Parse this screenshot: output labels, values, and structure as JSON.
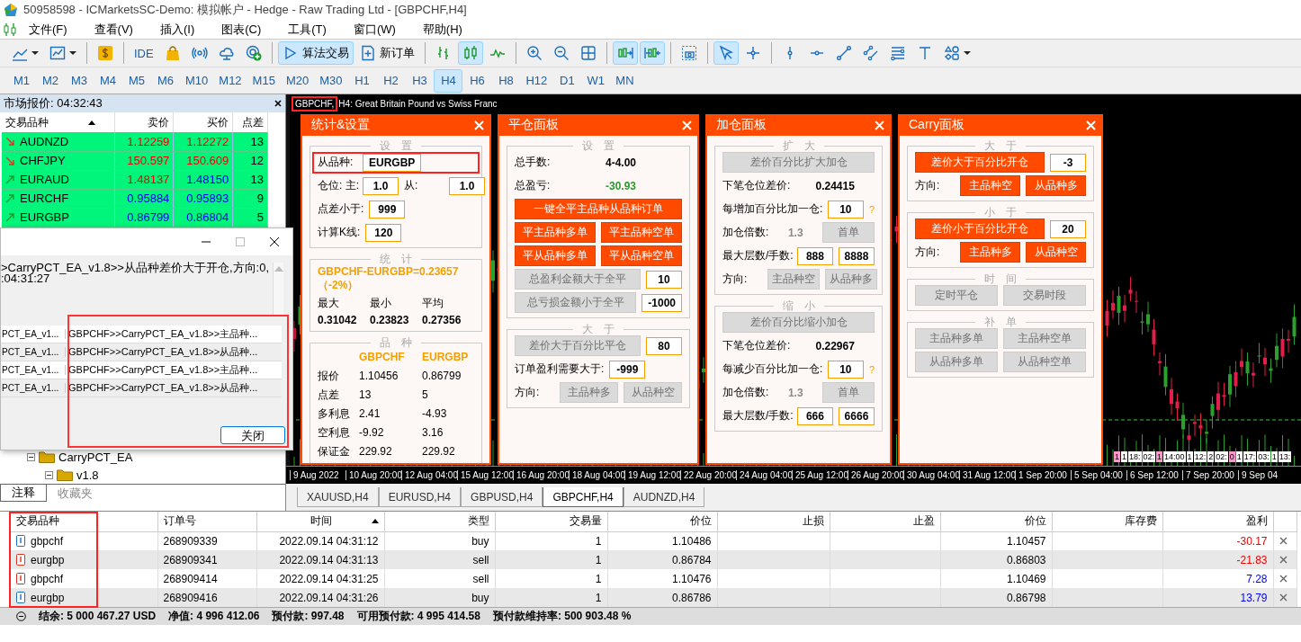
{
  "window": {
    "title": "50958598 - ICMarketsSC-Demo: 模拟帐户 - Hedge - Raw Trading Ltd - [GBPCHF,H4]"
  },
  "menu": [
    "文件(F)",
    "查看(V)",
    "插入(I)",
    "图表(C)",
    "工具(T)",
    "窗口(W)",
    "帮助(H)"
  ],
  "toolbar": [
    {
      "kind": "icon",
      "selected": false
    },
    {
      "kind": "icon",
      "selected": false
    },
    {
      "kind": "separator"
    },
    {
      "kind": "icon",
      "selected": false
    },
    {
      "kind": "separator"
    },
    {
      "kind": "text",
      "label": "IDE",
      "selected": false
    },
    {
      "kind": "icon",
      "selected": false
    },
    {
      "kind": "icon",
      "selected": false
    },
    {
      "kind": "icon",
      "selected": false
    },
    {
      "kind": "icon",
      "selected": false
    },
    {
      "kind": "separator"
    },
    {
      "kind": "text",
      "label": "算法交易",
      "selected": true
    },
    {
      "kind": "text",
      "label": "新订单",
      "selected": false
    },
    {
      "kind": "separator"
    },
    {
      "kind": "icon",
      "selected": false
    },
    {
      "kind": "icon",
      "selected": true
    },
    {
      "kind": "icon",
      "selected": false
    },
    {
      "kind": "separator"
    },
    {
      "kind": "icon",
      "selected": false
    },
    {
      "kind": "icon",
      "selected": false
    },
    {
      "kind": "icon",
      "selected": false
    },
    {
      "kind": "separator"
    },
    {
      "kind": "icon",
      "selected": true
    },
    {
      "kind": "icon",
      "selected": true
    },
    {
      "kind": "separator"
    },
    {
      "kind": "icon",
      "selected": false
    },
    {
      "kind": "separator"
    },
    {
      "kind": "icon",
      "selected": true
    },
    {
      "kind": "icon",
      "selected": false
    },
    {
      "kind": "separator"
    },
    {
      "kind": "icon",
      "selected": false
    },
    {
      "kind": "icon",
      "selected": false
    },
    {
      "kind": "icon",
      "selected": false
    },
    {
      "kind": "icon",
      "selected": false
    },
    {
      "kind": "icon",
      "selected": false
    },
    {
      "kind": "icon",
      "selected": false
    },
    {
      "kind": "icon",
      "selected": false
    }
  ],
  "timeframes": [
    {
      "label": "M1",
      "selected": false
    },
    {
      "label": "M2",
      "selected": false
    },
    {
      "label": "M3",
      "selected": false
    },
    {
      "label": "M4",
      "selected": false
    },
    {
      "label": "M5",
      "selected": false
    },
    {
      "label": "M6",
      "selected": false
    },
    {
      "label": "M10",
      "selected": false
    },
    {
      "label": "M12",
      "selected": false
    },
    {
      "label": "M15",
      "selected": false
    },
    {
      "label": "M20",
      "selected": false
    },
    {
      "label": "M30",
      "selected": false
    },
    {
      "label": "H1",
      "selected": false
    },
    {
      "label": "H2",
      "selected": false
    },
    {
      "label": "H3",
      "selected": false
    },
    {
      "label": "H4",
      "selected": true
    },
    {
      "label": "H6",
      "selected": false
    },
    {
      "label": "H8",
      "selected": false
    },
    {
      "label": "H12",
      "selected": false
    },
    {
      "label": "D1",
      "selected": false
    },
    {
      "label": "W1",
      "selected": false
    },
    {
      "label": "MN",
      "selected": false
    }
  ],
  "market_watch": {
    "title": "市场报价: 04:32:43",
    "columns": [
      {
        "label": "交易品种",
        "sorted": true
      },
      {
        "label": "卖价",
        "sorted": false
      },
      {
        "label": "买价",
        "sorted": false
      },
      {
        "label": "点差",
        "sorted": false
      }
    ],
    "rows": [
      {
        "symbol": "AUDNZD",
        "falling": true,
        "bid": "1.12259",
        "bid_falling": true,
        "ask": "1.12272",
        "ask_falling": true,
        "spread": "13"
      },
      {
        "symbol": "CHFJPY",
        "falling": true,
        "bid": "150.597",
        "bid_falling": true,
        "ask": "150.609",
        "ask_falling": true,
        "spread": "12"
      },
      {
        "symbol": "EURAUD",
        "falling": false,
        "bid": "1.48137",
        "bid_falling": true,
        "ask": "1.48150",
        "ask_falling": false,
        "spread": "13"
      },
      {
        "symbol": "EURCHF",
        "falling": false,
        "bid": "0.95884",
        "bid_falling": false,
        "ask": "0.95893",
        "ask_falling": false,
        "spread": "9"
      },
      {
        "symbol": "EURGBP",
        "falling": false,
        "bid": "0.86799",
        "bid_falling": false,
        "ask": "0.86804",
        "ask_falling": false,
        "spread": "5"
      }
    ]
  },
  "dialog": {
    "message": [
      ">CarryPCT_EA_v1.8>>从品种差价大于开仓,方向:0,",
      ":04:31:27"
    ],
    "highlighted": true,
    "rows": [
      {
        "column_1": "PCT_EA_v1...",
        "column_2": "GBPCHF>>CarryPCT_EA_v1.8>>主品种..."
      },
      {
        "column_1": "PCT_EA_v1...",
        "column_2": "GBPCHF>>CarryPCT_EA_v1.8>>从品种..."
      },
      {
        "column_1": "PCT_EA_v1...",
        "column_2": "GBPCHF>>CarryPCT_EA_v1.8>>主品种..."
      },
      {
        "column_1": "PCT_EA_v1...",
        "column_2": "GBPCHF>>CarryPCT_EA_v1.8>>从品种..."
      }
    ],
    "button": "关闭"
  },
  "navigator": {
    "tree": [
      {
        "label": "CarryPCT_EA",
        "expanded": true,
        "children": [
          {
            "label": "v1.8",
            "expanded": true
          }
        ]
      }
    ],
    "tabs": [
      {
        "label": "注释",
        "selected": true
      },
      {
        "label": "收藏夹",
        "selected": false
      }
    ]
  },
  "chart": {
    "symbol": "GBPCHF,",
    "symbol_highlighted": true,
    "description": "H4:  Great Britain Pound vs Swiss Franc",
    "panels": [
      {
        "title": "统计&设置",
        "sections": [
          {
            "title": "设　置",
            "rows": [
              {
                "kind": "line",
                "highlighted": true,
                "items": [
                  {
                    "kind": "label",
                    "text": "从品种:"
                  },
                  {
                    "kind": "input",
                    "value": "EURGBP"
                  }
                ]
              },
              {
                "kind": "line",
                "items": [
                  {
                    "kind": "label",
                    "text": "仓位: 主:"
                  },
                  {
                    "kind": "input",
                    "value": "1.0"
                  },
                  {
                    "kind": "label",
                    "text": "从:"
                  },
                  {
                    "kind": "input",
                    "value": "1.0"
                  }
                ]
              },
              {
                "kind": "line",
                "items": [
                  {
                    "kind": "label",
                    "text": "点差小于:"
                  },
                  {
                    "kind": "input",
                    "value": "999"
                  }
                ]
              },
              {
                "kind": "line",
                "items": [
                  {
                    "kind": "label",
                    "text": "计算K线:"
                  },
                  {
                    "kind": "input",
                    "value": "120"
                  }
                ]
              }
            ]
          },
          {
            "title": "统　计",
            "rows": [
              {
                "kind": "line",
                "items": [
                  {
                    "kind": "accent",
                    "text": "GBPCHF-EURGBP=0.23657（-2%）"
                  }
                ]
              },
              {
                "kind": "stat",
                "bold": false,
                "cells": [
                  "最大",
                  "最小",
                  "平均"
                ]
              },
              {
                "kind": "stat",
                "bold": true,
                "cells": [
                  "0.31042",
                  "0.23823",
                  "0.27356"
                ]
              }
            ]
          },
          {
            "title": "品　种",
            "rows": [
              {
                "kind": "table_head",
                "cells": [
                  "GBPCHF",
                  "EURGBP"
                ]
              },
              {
                "kind": "table",
                "label": "报价",
                "cells": [
                  "1.10456",
                  "0.86799"
                ]
              },
              {
                "kind": "table",
                "label": "点差",
                "cells": [
                  "13",
                  "5"
                ]
              },
              {
                "kind": "table",
                "label": "多利息",
                "cells": [
                  "2.41",
                  "-4.93"
                ]
              },
              {
                "kind": "table",
                "label": "空利息",
                "cells": [
                  "-9.92",
                  "3.16"
                ]
              },
              {
                "kind": "table",
                "label": "保证金",
                "cells": [
                  "229.92",
                  "229.92"
                ]
              }
            ]
          }
        ]
      },
      {
        "title": "平仓面板",
        "sections": [
          {
            "title": "设　置",
            "rows": [
              {
                "kind": "line",
                "items": [
                  {
                    "kind": "label",
                    "text": "总手数:"
                  },
                  {
                    "kind": "value",
                    "text": "4-4.00"
                  }
                ]
              },
              {
                "kind": "line",
                "items": [
                  {
                    "kind": "label",
                    "text": "总盈亏:"
                  },
                  {
                    "kind": "gain",
                    "text": "-30.93"
                  }
                ]
              },
              {
                "kind": "line",
                "items": [
                  {
                    "kind": "button",
                    "text": "一键全平主品种从品种订单",
                    "enabled": true
                  }
                ]
              },
              {
                "kind": "line",
                "items": [
                  {
                    "kind": "button",
                    "text": "平主品种多单",
                    "enabled": true
                  },
                  {
                    "kind": "button",
                    "text": "平主品种空单",
                    "enabled": true
                  }
                ]
              },
              {
                "kind": "line",
                "items": [
                  {
                    "kind": "button",
                    "text": "平从品种多单",
                    "enabled": true
                  },
                  {
                    "kind": "button",
                    "text": "平从品种空单",
                    "enabled": true
                  }
                ]
              },
              {
                "kind": "line",
                "items": [
                  {
                    "kind": "button",
                    "text": "总盈利金额大于全平",
                    "enabled": false
                  },
                  {
                    "kind": "input",
                    "value": "10"
                  }
                ]
              },
              {
                "kind": "line",
                "items": [
                  {
                    "kind": "button",
                    "text": "总亏损金额小于全平",
                    "enabled": false
                  },
                  {
                    "kind": "input",
                    "value": "-1000"
                  }
                ]
              }
            ]
          },
          {
            "title": "大　于",
            "rows": [
              {
                "kind": "line",
                "items": [
                  {
                    "kind": "button",
                    "text": "差价大于百分比平仓",
                    "enabled": false
                  },
                  {
                    "kind": "input",
                    "value": "80"
                  }
                ]
              },
              {
                "kind": "line",
                "items": [
                  {
                    "kind": "label",
                    "text": "订单盈利需要大于:"
                  },
                  {
                    "kind": "input",
                    "value": "-999"
                  }
                ]
              },
              {
                "kind": "line",
                "items": [
                  {
                    "kind": "label",
                    "text": "方向:"
                  },
                  {
                    "kind": "button",
                    "text": "主品种多",
                    "enabled": false
                  },
                  {
                    "kind": "button",
                    "text": "从品种空",
                    "enabled": false
                  }
                ]
              }
            ]
          }
        ]
      },
      {
        "title": "加仓面板",
        "sections": [
          {
            "title": "扩　大",
            "rows": [
              {
                "kind": "line",
                "items": [
                  {
                    "kind": "button",
                    "text": "差价百分比扩大加仓",
                    "enabled": false
                  }
                ]
              },
              {
                "kind": "line",
                "items": [
                  {
                    "kind": "label",
                    "text": "下笔仓位差价:"
                  },
                  {
                    "kind": "value",
                    "text": "0.24415"
                  }
                ]
              },
              {
                "kind": "line",
                "items": [
                  {
                    "kind": "label",
                    "text": "每增加百分比加一仓:"
                  },
                  {
                    "kind": "input",
                    "value": "10"
                  },
                  {
                    "kind": "hint",
                    "text": "?"
                  }
                ]
              },
              {
                "kind": "line",
                "items": [
                  {
                    "kind": "label",
                    "text": "加仓倍数:"
                  },
                  {
                    "kind": "muted",
                    "text": "1.3"
                  },
                  {
                    "kind": "button",
                    "text": "首单",
                    "enabled": false
                  }
                ]
              },
              {
                "kind": "line",
                "items": [
                  {
                    "kind": "label",
                    "text": "最大层数/手数:"
                  },
                  {
                    "kind": "input",
                    "value": "888"
                  },
                  {
                    "kind": "input",
                    "value": "8888"
                  }
                ]
              },
              {
                "kind": "line",
                "items": [
                  {
                    "kind": "label",
                    "text": "方向:"
                  },
                  {
                    "kind": "button",
                    "text": "主品种空",
                    "enabled": false
                  },
                  {
                    "kind": "button",
                    "text": "从品种多",
                    "enabled": false
                  }
                ]
              }
            ]
          },
          {
            "title": "缩　小",
            "rows": [
              {
                "kind": "line",
                "items": [
                  {
                    "kind": "button",
                    "text": "差价百分比缩小加仓",
                    "enabled": false
                  }
                ]
              },
              {
                "kind": "line",
                "items": [
                  {
                    "kind": "label",
                    "text": "下笔仓位差价:"
                  },
                  {
                    "kind": "value",
                    "text": "0.22967"
                  }
                ]
              },
              {
                "kind": "line",
                "items": [
                  {
                    "kind": "label",
                    "text": "每减少百分比加一仓:"
                  },
                  {
                    "kind": "input",
                    "value": "10"
                  },
                  {
                    "kind": "hint",
                    "text": "?"
                  }
                ]
              },
              {
                "kind": "line",
                "items": [
                  {
                    "kind": "label",
                    "text": "加仓倍数:"
                  },
                  {
                    "kind": "muted",
                    "text": "1.3"
                  },
                  {
                    "kind": "button",
                    "text": "首单",
                    "enabled": false
                  }
                ]
              },
              {
                "kind": "line",
                "items": [
                  {
                    "kind": "label",
                    "text": "最大层数/手数:"
                  },
                  {
                    "kind": "input",
                    "value": "666"
                  },
                  {
                    "kind": "input",
                    "value": "6666"
                  }
                ]
              }
            ]
          }
        ]
      },
      {
        "title": "Carry面板",
        "sections": [
          {
            "title": "大　于",
            "rows": [
              {
                "kind": "line",
                "items": [
                  {
                    "kind": "button",
                    "text": "差价大于百分比开仓",
                    "enabled": true
                  },
                  {
                    "kind": "input",
                    "value": "-3"
                  }
                ]
              },
              {
                "kind": "line",
                "items": [
                  {
                    "kind": "label",
                    "text": "方向:"
                  },
                  {
                    "kind": "button",
                    "text": "主品种空",
                    "enabled": true
                  },
                  {
                    "kind": "button",
                    "text": "从品种多",
                    "enabled": true
                  }
                ]
              }
            ]
          },
          {
            "title": "小　于",
            "rows": [
              {
                "kind": "line",
                "items": [
                  {
                    "kind": "button",
                    "text": "差价小于百分比开仓",
                    "enabled": true
                  },
                  {
                    "kind": "input",
                    "value": "20"
                  }
                ]
              },
              {
                "kind": "line",
                "items": [
                  {
                    "kind": "label",
                    "text": "方向:"
                  },
                  {
                    "kind": "button",
                    "text": "主品种多",
                    "enabled": true
                  },
                  {
                    "kind": "button",
                    "text": "从品种空",
                    "enabled": true
                  }
                ]
              }
            ]
          },
          {
            "title": "时　间",
            "rows": [
              {
                "kind": "line",
                "items": [
                  {
                    "kind": "button",
                    "text": "定时平仓",
                    "enabled": false
                  },
                  {
                    "kind": "button",
                    "text": "交易时段",
                    "enabled": false
                  }
                ]
              }
            ]
          },
          {
            "title": "补　单",
            "rows": [
              {
                "kind": "line",
                "items": [
                  {
                    "kind": "button",
                    "text": "主品种多单",
                    "enabled": false
                  },
                  {
                    "kind": "button",
                    "text": "主品种空单",
                    "enabled": false
                  }
                ]
              },
              {
                "kind": "line",
                "items": [
                  {
                    "kind": "button",
                    "text": "从品种多单",
                    "enabled": false
                  },
                  {
                    "kind": "button",
                    "text": "从品种空单",
                    "enabled": false
                  }
                ]
              }
            ]
          }
        ]
      }
    ],
    "object_labels": [
      {
        "text": "1",
        "marked": true
      },
      {
        "text": "1",
        "marked": false
      },
      {
        "text": "18:",
        "marked": false
      },
      {
        "text": "02:",
        "marked": false
      },
      {
        "text": "1",
        "marked": true
      },
      {
        "text": "14:00",
        "marked": false
      },
      {
        "text": "1",
        "marked": false
      },
      {
        "text": "12:",
        "marked": false
      },
      {
        "text": "2",
        "marked": false
      },
      {
        "text": "02:",
        "marked": false
      },
      {
        "text": "0",
        "marked": true
      },
      {
        "text": "1",
        "marked": false
      },
      {
        "text": "17:",
        "marked": false
      },
      {
        "text": "03:",
        "marked": false
      },
      {
        "text": "1",
        "marked": false
      },
      {
        "text": "13:",
        "marked": false
      }
    ],
    "time_axis": [
      "9 Aug 2022",
      "10 Aug 20:00",
      "12 Aug 04:00",
      "15 Aug 12:00",
      "16 Aug 20:00",
      "18 Aug 04:00",
      "19 Aug 12:00",
      "22 Aug 20:00",
      "24 Aug 04:00",
      "25 Aug 12:00",
      "26 Aug 20:00",
      "30 Aug 04:00",
      "31 Aug 12:00",
      "1 Sep 20:00",
      "5 Sep 04:00",
      "6 Sep 12:00",
      "7 Sep 20:00",
      "9 Sep 04"
    ]
  },
  "chart_tabs": [
    {
      "label": "XAUUSD,H4",
      "selected": false
    },
    {
      "label": "EURUSD,H4",
      "selected": false
    },
    {
      "label": "GBPUSD,H4",
      "selected": false
    },
    {
      "label": "GBPCHF,H4",
      "selected": true
    },
    {
      "label": "AUDNZD,H4",
      "selected": false
    }
  ],
  "orders": {
    "highlight_first_column": true,
    "columns": [
      {
        "label": "交易品种",
        "sorted": false
      },
      {
        "label": "订单号",
        "sorted": false
      },
      {
        "label": "时间",
        "sorted": true
      },
      {
        "label": "类型",
        "sorted": false
      },
      {
        "label": "交易量",
        "sorted": false
      },
      {
        "label": "价位",
        "sorted": false
      },
      {
        "label": "止损",
        "sorted": false
      },
      {
        "label": "止盈",
        "sorted": false
      },
      {
        "label": "价位",
        "sorted": false
      },
      {
        "label": "库存费",
        "sorted": false
      },
      {
        "label": "盈利",
        "sorted": false
      }
    ],
    "rows": [
      {
        "kind": "buy",
        "loss": true,
        "cells": [
          "gbpchf",
          "268909339",
          "2022.09.14 04:31:12",
          "buy",
          "1",
          "1.10486",
          "",
          "",
          "1.10457",
          "",
          "-30.17"
        ]
      },
      {
        "kind": "sell",
        "loss": true,
        "cells": [
          "eurgbp",
          "268909341",
          "2022.09.14 04:31:13",
          "sell",
          "1",
          "0.86784",
          "",
          "",
          "0.86803",
          "",
          "-21.83"
        ]
      },
      {
        "kind": "sell",
        "loss": false,
        "cells": [
          "gbpchf",
          "268909414",
          "2022.09.14 04:31:25",
          "sell",
          "1",
          "1.10476",
          "",
          "",
          "1.10469",
          "",
          "7.28"
        ]
      },
      {
        "kind": "buy",
        "loss": false,
        "cells": [
          "eurgbp",
          "268909416",
          "2022.09.14 04:31:26",
          "buy",
          "1",
          "0.86786",
          "",
          "",
          "0.86798",
          "",
          "13.79"
        ]
      }
    ],
    "summary": [
      "结余: 5 000 467.27 USD",
      "净值: 4 996 412.06",
      "预付款: 997.48",
      "可用预付款: 4 995 414.58",
      "预付款维持率: 500 903.48 %"
    ]
  }
}
